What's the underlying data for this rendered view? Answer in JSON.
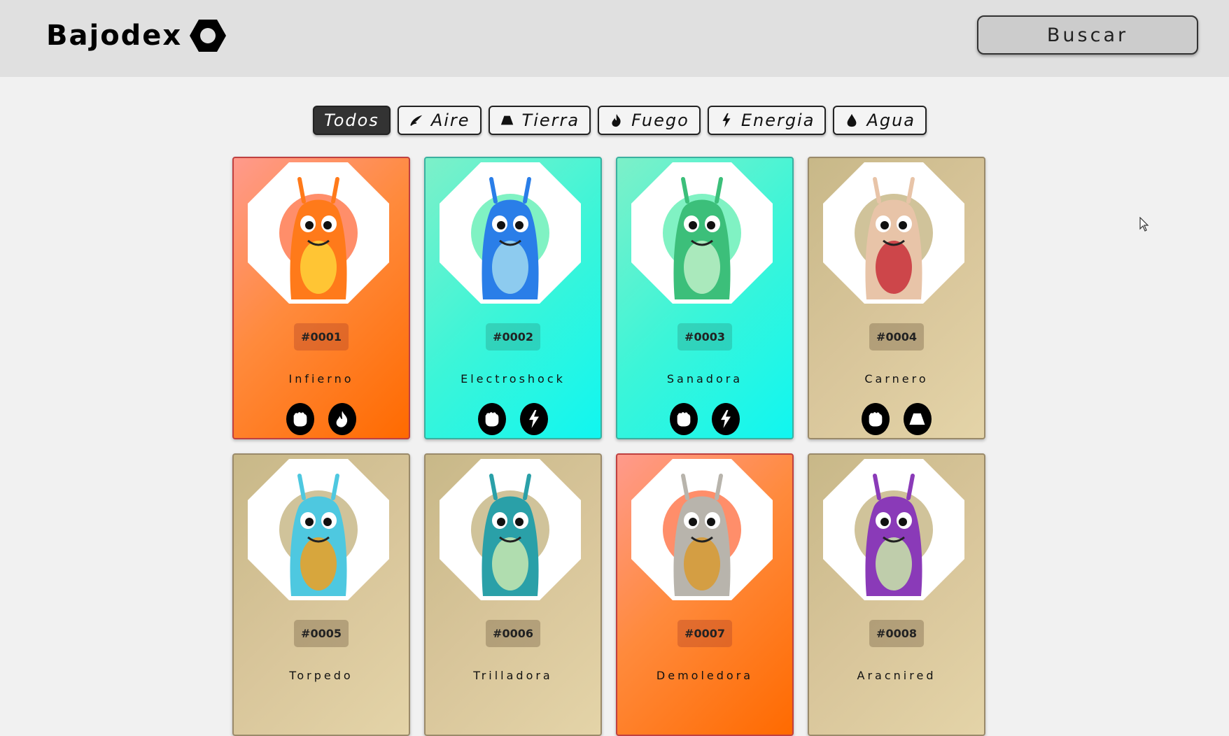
{
  "app": {
    "title": "Bajodex",
    "search_label": "Buscar"
  },
  "filters": [
    {
      "label": "Todos",
      "icon": "",
      "active": true
    },
    {
      "label": "Aire",
      "icon": "air-icon",
      "active": false
    },
    {
      "label": "Tierra",
      "icon": "earth-icon",
      "active": false
    },
    {
      "label": "Fuego",
      "icon": "fire-icon",
      "active": false
    },
    {
      "label": "Energia",
      "icon": "energy-icon",
      "active": false
    },
    {
      "label": "Agua",
      "icon": "water-icon",
      "active": false
    }
  ],
  "cards": [
    {
      "number": "#0001",
      "name": "Infierno",
      "theme": "fire",
      "types": [
        "fist-icon",
        "fire-icon"
      ],
      "body_color": "#ff7a1a",
      "accent": "#ffd23a"
    },
    {
      "number": "#0002",
      "name": "Electroshock",
      "theme": "energy",
      "types": [
        "fist-icon",
        "energy-icon"
      ],
      "body_color": "#2a7ee8",
      "accent": "#9fd8f0"
    },
    {
      "number": "#0003",
      "name": "Sanadora",
      "theme": "energy",
      "types": [
        "fist-icon",
        "energy-icon"
      ],
      "body_color": "#3cbf7a",
      "accent": "#bdf0c8"
    },
    {
      "number": "#0004",
      "name": "Carnero",
      "theme": "earth",
      "types": [
        "fist-icon",
        "earth-icon"
      ],
      "body_color": "#e8c4a8",
      "accent": "#c8303a"
    },
    {
      "number": "#0005",
      "name": "Torpedo",
      "theme": "earth",
      "types": [],
      "body_color": "#4ec8e0",
      "accent": "#f0a020"
    },
    {
      "number": "#0006",
      "name": "Trilladora",
      "theme": "earth",
      "types": [],
      "body_color": "#2aa0a8",
      "accent": "#c8e8b0"
    },
    {
      "number": "#0007",
      "name": "Demoledora",
      "theme": "fire",
      "types": [],
      "body_color": "#b8b4ac",
      "accent": "#d89a30"
    },
    {
      "number": "#0008",
      "name": "Aracnired",
      "theme": "earth",
      "types": [],
      "body_color": "#8a3ab8",
      "accent": "#c8e8a8"
    }
  ]
}
